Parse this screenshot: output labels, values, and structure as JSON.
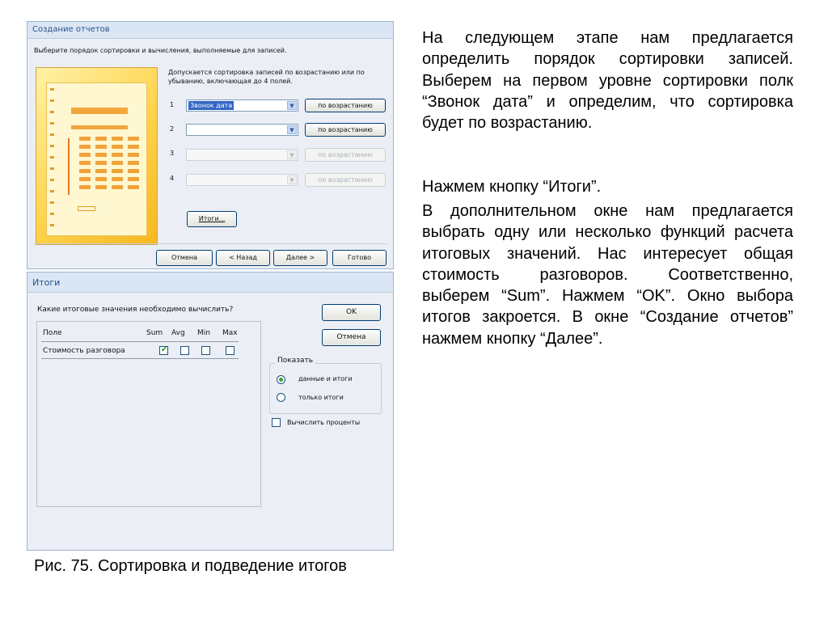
{
  "report_wizard": {
    "title": "Создание отчетов",
    "instruction": "Выберите порядок сортировки и вычисления, выполняемые для записей.",
    "description": "Допускается сортировка записей по возрастанию или по убыванию, включающая до 4 полей.",
    "levels": [
      {
        "num": "1",
        "field": "Звонок дата",
        "order": "по возрастанию",
        "enabled": true
      },
      {
        "num": "2",
        "field": "",
        "order": "по возрастанию",
        "enabled": true
      },
      {
        "num": "3",
        "field": "",
        "order": "по возрастанию",
        "enabled": false
      },
      {
        "num": "4",
        "field": "",
        "order": "по возрастанию",
        "enabled": false
      }
    ],
    "summary_button": "Итоги...",
    "footer": {
      "cancel": "Отмена",
      "back": "< Назад",
      "next": "Далее >",
      "finish": "Готово"
    }
  },
  "summary_dialog": {
    "title": "Итоги",
    "question": "Какие итоговые значения необходимо вычислить?",
    "columns": {
      "field": "Поле",
      "sum": "Sum",
      "avg": "Avg",
      "min": "Min",
      "max": "Max"
    },
    "rows": [
      {
        "field": "Стоимость разговора",
        "sum": true,
        "avg": false,
        "min": false,
        "max": false
      }
    ],
    "ok": "OK",
    "cancel": "Отмена",
    "show_group": "Показать",
    "options": [
      {
        "label": "данные и итоги",
        "selected": true
      },
      {
        "label": "только итоги",
        "selected": false
      }
    ],
    "percent_checkbox": {
      "label": "Вычислить проценты",
      "checked": false
    }
  },
  "text": {
    "p1": "На следующем этапе нам предлагается определить порядок сортировки записей. Выберем на первом уровне сортировки полк “Звонок дата” и определим, что сортировка будет по возрастанию.",
    "p2": "Нажмем кнопку “Итоги”.",
    "p3": "В дополнительном окне нам предлагается выбрать одну или несколько функций расчета итоговых значений. Нас интересует общая стоимость разговоров. Соответственно, выберем “Sum”. Нажмем “OK”. Окно выбора итогов закроется. В окне “Создание отчетов” нажмем кнопку “Далее”."
  },
  "caption": "Рис. 75. Сортировка и подведение итогов"
}
